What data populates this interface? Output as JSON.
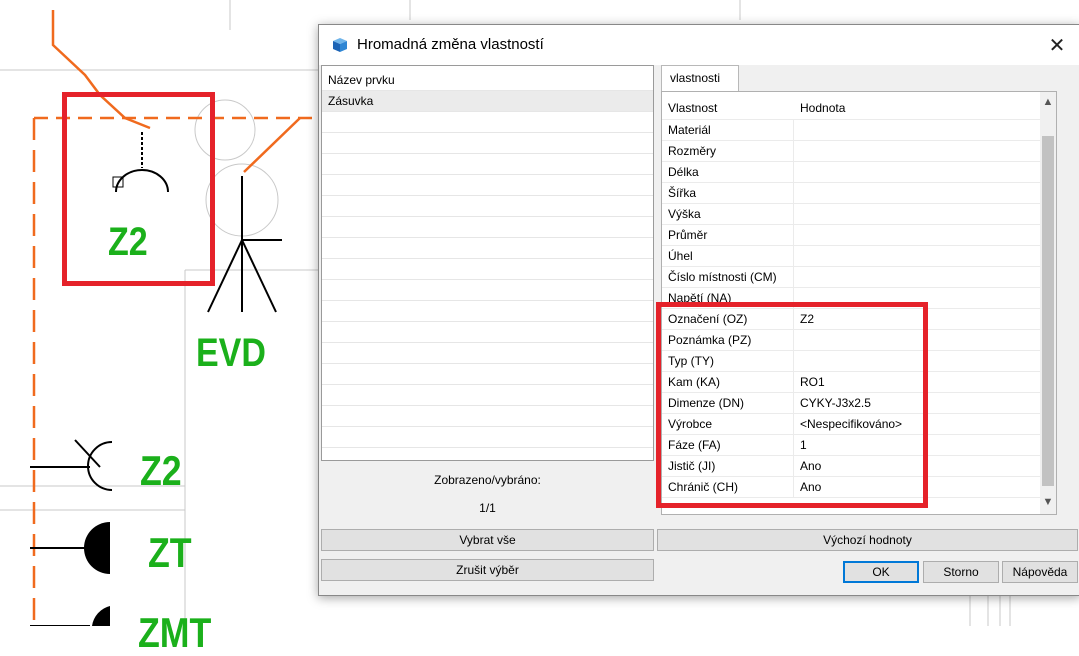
{
  "canvas": {
    "labels": [
      "Z2",
      "EVD",
      "Z2",
      "ZT",
      "ZMT"
    ]
  },
  "dialog": {
    "title": "Hromadná změna vlastností",
    "close_glyph": "✕",
    "element_list": {
      "header": "Název prvku",
      "items": [
        "Zásuvka"
      ]
    },
    "status_label": "Zobrazeno/vybráno:",
    "status_value": "1/1",
    "tab_label": "vlastnosti",
    "properties": {
      "header": {
        "name": "Vlastnost",
        "value": "Hodnota"
      },
      "rows": [
        {
          "name": "Materiál",
          "value": ""
        },
        {
          "name": "Rozměry",
          "value": ""
        },
        {
          "name": "Délka",
          "value": ""
        },
        {
          "name": "Šířka",
          "value": ""
        },
        {
          "name": "Výška",
          "value": ""
        },
        {
          "name": "Průměr",
          "value": ""
        },
        {
          "name": "Úhel",
          "value": ""
        },
        {
          "name": "Číslo místnosti (CM)",
          "value": ""
        },
        {
          "name": "Napětí (NA)",
          "value": ""
        },
        {
          "name": "Označení (OZ)",
          "value": "Z2"
        },
        {
          "name": "Poznámka (PZ)",
          "value": ""
        },
        {
          "name": "Typ (TY)",
          "value": ""
        },
        {
          "name": "Kam (KA)",
          "value": "RO1"
        },
        {
          "name": "Dimenze (DN)",
          "value": "CYKY-J3x2.5"
        },
        {
          "name": "Výrobce",
          "value": "<Nespecifikováno>"
        },
        {
          "name": "Fáze (FA)",
          "value": "1"
        },
        {
          "name": "Jistič (JI)",
          "value": "Ano"
        },
        {
          "name": "Chránič (CH)",
          "value": "Ano"
        }
      ]
    },
    "buttons": {
      "select_all": "Vybrat vše",
      "clear_selection": "Zrušit výběr",
      "defaults": "Výchozí hodnoty",
      "ok": "OK",
      "cancel": "Storno",
      "help": "Nápověda"
    }
  },
  "colors": {
    "highlight": "#e5222a",
    "cad_label": "#1bb01b",
    "cad_wire": "#f06a1e"
  }
}
